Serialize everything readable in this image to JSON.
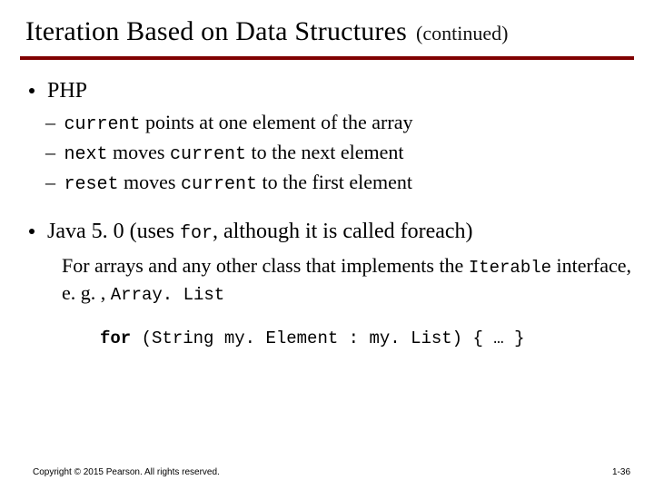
{
  "title": "Iteration Based on Data Structures",
  "subtitle": "(continued)",
  "php": {
    "heading": "PHP",
    "items": [
      {
        "pre": "– ",
        "c1": "current",
        "t1": " points at one element of the array"
      },
      {
        "pre": "– ",
        "c1": "next",
        "t1": " moves ",
        "c2": "current",
        "t2": " to the next element"
      },
      {
        "pre": "– ",
        "c1": "reset",
        "t1": " moves ",
        "c2": "current",
        "t2": " to the first element"
      }
    ]
  },
  "java": {
    "lead": "Java 5. 0 (uses ",
    "for": "for",
    "tail": ", although it is called foreach)",
    "desc1": "For arrays and any other class that implements the ",
    "iterable": "Iterable",
    "desc2": " interface, e. g. , ",
    "arraylist": "Array. List",
    "code_kw": "for",
    "code_rest": " (String my. Element : my. List) { … }"
  },
  "footer": {
    "copyright": "Copyright © 2015 Pearson. All rights reserved.",
    "page": "1-36"
  }
}
